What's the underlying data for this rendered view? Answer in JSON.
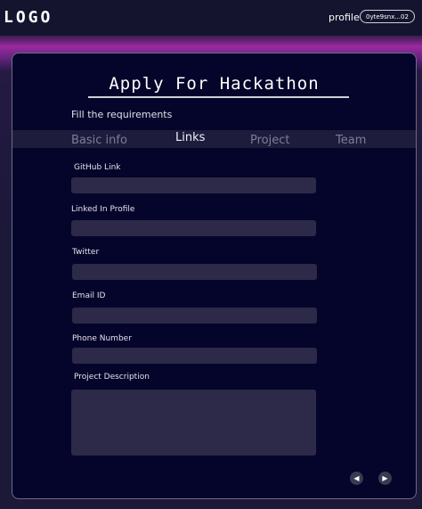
{
  "header": {
    "logo": "LOGO",
    "profile_label": "profile",
    "wallet_address": "0yte9snx...02"
  },
  "form": {
    "title": "Apply For Hackathon",
    "subtitle": "Fill the requirements",
    "tabs": [
      {
        "label": "Basic info",
        "active": false
      },
      {
        "label": "Links",
        "active": true
      },
      {
        "label": "Project",
        "active": false
      },
      {
        "label": "Team",
        "active": false
      }
    ],
    "fields": {
      "github": {
        "label": "GitHub Link",
        "value": ""
      },
      "linkedin": {
        "label": "Linked In Profile",
        "value": ""
      },
      "twitter": {
        "label": "Twitter",
        "value": ""
      },
      "email": {
        "label": "Email ID",
        "value": ""
      },
      "phone": {
        "label": "Phone Number",
        "value": ""
      },
      "description": {
        "label": "Project Description",
        "value": ""
      }
    },
    "nav": {
      "prev_icon": "caret-left-icon",
      "next_icon": "caret-right-icon"
    }
  },
  "colors": {
    "background": "#1b1838",
    "card": "#05042a",
    "input": "#2c2a48",
    "accent_glow": "#9a2aa0"
  }
}
